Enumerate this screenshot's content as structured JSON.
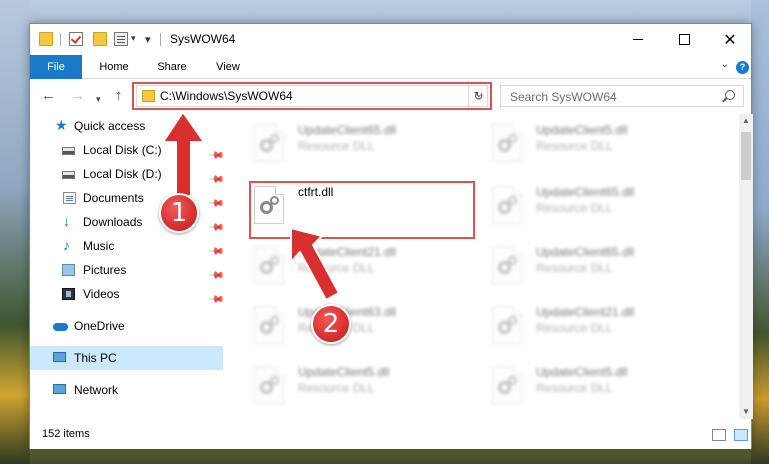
{
  "window": {
    "title": "SysWOW64",
    "controls": {
      "minimize": "",
      "maximize": "",
      "close": "✕"
    }
  },
  "ribbon": {
    "tabs": [
      "File",
      "Home",
      "Share",
      "View"
    ],
    "help": "?"
  },
  "nav": {
    "address": "C:\\Windows\\SysWOW64",
    "search_placeholder": "Search SysWOW64"
  },
  "sidebar": {
    "items": [
      {
        "label": "Quick access",
        "icon": "star-icon",
        "pinned": false
      },
      {
        "label": "Local Disk (C:)",
        "icon": "drive-icon",
        "pinned": true
      },
      {
        "label": "Local Disk (D:)",
        "icon": "drive-icon",
        "pinned": true
      },
      {
        "label": "Documents",
        "icon": "documents-icon",
        "pinned": true
      },
      {
        "label": "Downloads",
        "icon": "download-icon",
        "pinned": true
      },
      {
        "label": "Music",
        "icon": "music-icon",
        "pinned": true
      },
      {
        "label": "Pictures",
        "icon": "pictures-icon",
        "pinned": true
      },
      {
        "label": "Videos",
        "icon": "videos-icon",
        "pinned": true
      },
      {
        "label": "OneDrive",
        "icon": "cloud-icon",
        "pinned": false
      },
      {
        "label": "This PC",
        "icon": "computer-icon",
        "pinned": false,
        "selected": true
      },
      {
        "label": "Network",
        "icon": "network-icon",
        "pinned": false
      }
    ]
  },
  "files": [
    {
      "name": "UpdateClient65.dll",
      "type": "Resource DLL",
      "blurred": true
    },
    {
      "name": "UpdateClient5.dll",
      "type": "Resource DLL",
      "blurred": true
    },
    {
      "name": "ctfrt.dll",
      "type": "",
      "blurred": false
    },
    {
      "name": "UpdateClient65.dll",
      "type": "Resource DLL",
      "blurred": true
    },
    {
      "name": "UpdateClient21.dll",
      "type": "Resource DLL",
      "blurred": true
    },
    {
      "name": "UpdateClient65.dll",
      "type": "Resource DLL",
      "blurred": true
    },
    {
      "name": "UpdateClient63.dll",
      "type": "Resource DLL",
      "blurred": true
    },
    {
      "name": "UpdateClient21.dll",
      "type": "Resource DLL",
      "blurred": true
    },
    {
      "name": "UpdateClient5.dll",
      "type": "Resource DLL",
      "blurred": true
    },
    {
      "name": "UpdateClient5.dll",
      "type": "Resource DLL",
      "blurred": true
    }
  ],
  "status": {
    "item_count": "152 items"
  },
  "annotations": {
    "step1": "1",
    "step2": "2"
  },
  "colors": {
    "accent": "#1979ca",
    "highlight": "#d9534f",
    "selection": "#cce8ff"
  }
}
